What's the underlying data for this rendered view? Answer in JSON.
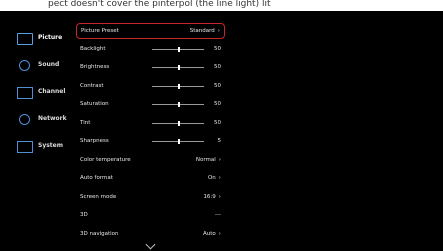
{
  "top_strip": {
    "caption": "pect doesn't cover the pinterpol (the line light) lit"
  },
  "sidebar": {
    "items": [
      {
        "label": "Picture",
        "icon": "monitor-icon",
        "active": true
      },
      {
        "label": "Sound",
        "icon": "speaker-icon",
        "active": false
      },
      {
        "label": "Channel",
        "icon": "tv-icon",
        "active": false
      },
      {
        "label": "Network",
        "icon": "globe-icon",
        "active": false
      },
      {
        "label": "System",
        "icon": "settings-icon",
        "active": false
      }
    ]
  },
  "menu": {
    "rows": [
      {
        "name": "Picture Preset",
        "value": "Standard",
        "type": "arrow",
        "selected": true
      },
      {
        "name": "Backlight",
        "value": "50",
        "type": "slider",
        "level": 0.5
      },
      {
        "name": "Brightness",
        "value": "50",
        "type": "slider",
        "level": 0.5
      },
      {
        "name": "Contrast",
        "value": "50",
        "type": "slider",
        "level": 0.5
      },
      {
        "name": "Saturation",
        "value": "50",
        "type": "slider",
        "level": 0.5
      },
      {
        "name": "Tint",
        "value": "50",
        "type": "slider",
        "level": 0.5
      },
      {
        "name": "Sharpness",
        "value": "5",
        "type": "slider",
        "level": 0.5
      },
      {
        "name": "Color temperature",
        "value": "Normal",
        "type": "arrow"
      },
      {
        "name": "Auto format",
        "value": "On",
        "type": "arrow"
      },
      {
        "name": "Screen mode",
        "value": "16:9",
        "type": "arrow"
      },
      {
        "name": "3D",
        "value": "---",
        "type": "text"
      },
      {
        "name": "3D navigation",
        "value": "Auto",
        "type": "arrow"
      }
    ],
    "arrow_glyph": "›",
    "more_icon": "chevron-down-icon"
  }
}
